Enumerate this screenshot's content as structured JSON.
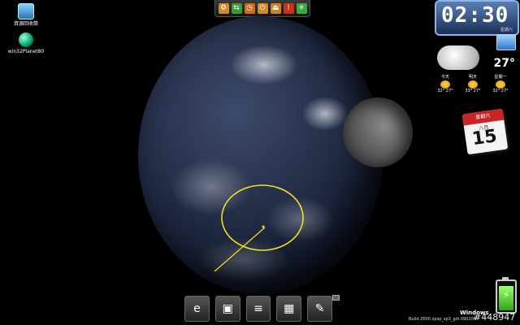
{
  "desktop_icons": [
    {
      "label": "資源回收筒",
      "icon": "recycle-bin-icon"
    },
    {
      "label": "win32Planet80",
      "icon": "planet-icon"
    }
  ],
  "toolbar": {
    "buttons": [
      {
        "icon": "wrench-icon",
        "glyph": "⚙",
        "color": "#d08a2c"
      },
      {
        "icon": "swap-icon",
        "glyph": "⇆",
        "color": "#3a9a3a"
      },
      {
        "icon": "clock-icon",
        "glyph": "◷",
        "color": "#d06a1c"
      },
      {
        "icon": "power-icon",
        "glyph": "⏻",
        "color": "#d08a2c"
      },
      {
        "icon": "eject-icon",
        "glyph": "⏏",
        "color": "#c8862a"
      },
      {
        "icon": "alert-icon",
        "glyph": "!",
        "color": "#c8301c"
      },
      {
        "icon": "burst-icon",
        "glyph": "✳",
        "color": "#3aa83a"
      }
    ]
  },
  "clock": {
    "time": "02:30",
    "sub": "星期六"
  },
  "weather": {
    "temperature": "27°",
    "forecast": [
      {
        "day": "今天",
        "range": "32° 27°"
      },
      {
        "day": "明天",
        "range": "33° 27°"
      },
      {
        "day": "星期一",
        "range": "32° 27°"
      }
    ]
  },
  "calendar": {
    "weekday": "星期六",
    "month": "八月",
    "day": "15"
  },
  "dock": [
    {
      "icon": "internet-explorer-icon",
      "glyph": "e"
    },
    {
      "icon": "computer-icon",
      "glyph": "▣"
    },
    {
      "icon": "notepad-icon",
      "glyph": "≡"
    },
    {
      "icon": "calculator-icon",
      "glyph": "▦"
    },
    {
      "icon": "paint-icon",
      "glyph": "✎"
    }
  ],
  "battery": {
    "level": 0.78
  },
  "watermark": {
    "os": "Windows",
    "build": "Build 2600.xpsp_sp3_gdr.090206",
    "id": "#448947"
  },
  "colors": {
    "orbit": "#f0e020",
    "clock_bg": "#1b2f58"
  }
}
